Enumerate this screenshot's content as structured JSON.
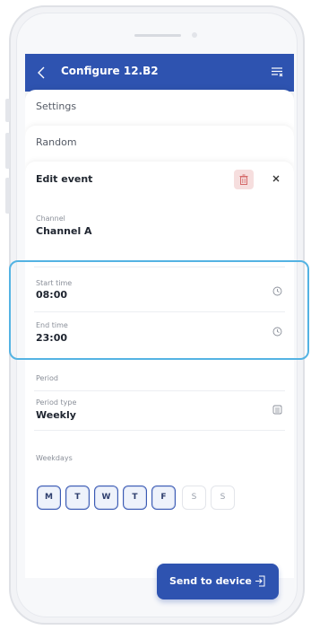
{
  "appbar": {
    "title": "Configure 12.B2"
  },
  "sections": {
    "settings": "Settings",
    "random": "Random",
    "edit_event": "Edit event"
  },
  "channel": {
    "label": "Channel",
    "value": "Channel A"
  },
  "start_time": {
    "label": "Start time",
    "value": "08:00"
  },
  "end_time": {
    "label": "End time",
    "value": "23:00"
  },
  "period": {
    "section_label": "Period",
    "type_label": "Period type",
    "type_value": "Weekly"
  },
  "weekdays": {
    "label": "Weekdays",
    "days": [
      {
        "letter": "M",
        "selected": true
      },
      {
        "letter": "T",
        "selected": true
      },
      {
        "letter": "W",
        "selected": true
      },
      {
        "letter": "T",
        "selected": true
      },
      {
        "letter": "F",
        "selected": true
      },
      {
        "letter": "S",
        "selected": false
      },
      {
        "letter": "S",
        "selected": false
      }
    ]
  },
  "send_button": {
    "label": "Send to device"
  },
  "colors": {
    "primary": "#2e53b0",
    "highlight": "#54b3e3",
    "delete_bg": "#f6dede",
    "delete_icon": "#d46a6a"
  },
  "icons": [
    "back-arrow-icon",
    "filter-list-icon",
    "trash-icon",
    "close-icon",
    "clock-icon",
    "list-icon",
    "sign-in-icon"
  ]
}
